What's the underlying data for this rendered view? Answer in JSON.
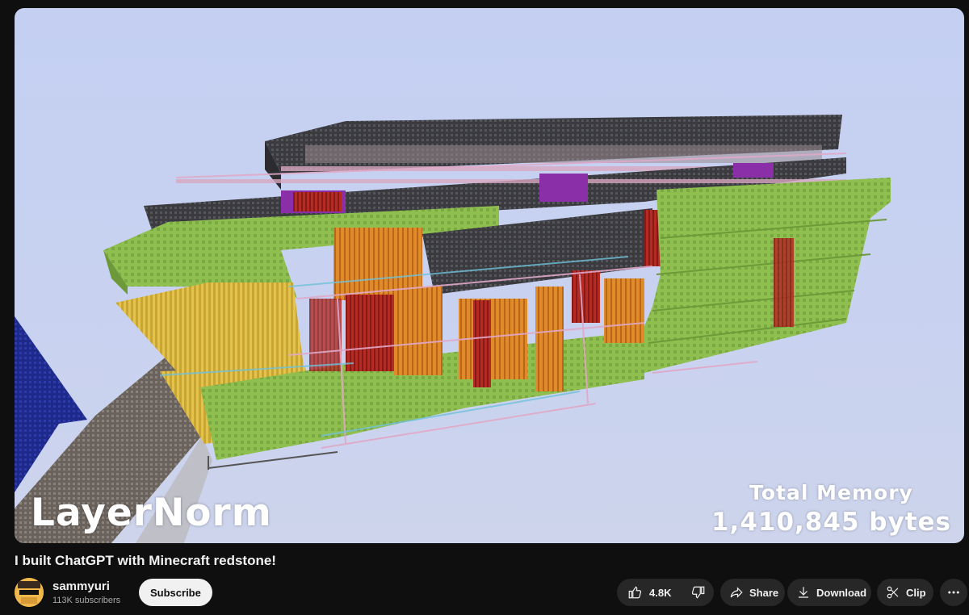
{
  "video": {
    "overlay_left": "LayerNorm",
    "overlay_right_line1": "Total Memory",
    "overlay_right_line2": "1,410,845 bytes"
  },
  "title": "I built ChatGPT with Minecraft redstone!",
  "channel": {
    "name": "sammyuri",
    "subscribers": "113K subscribers",
    "subscribe_label": "Subscribe"
  },
  "actions": {
    "like_count": "4.8K",
    "share_label": "Share",
    "download_label": "Download",
    "clip_label": "Clip"
  },
  "icons": {
    "like": "thumbs-up-icon",
    "dislike": "thumbs-down-icon",
    "share": "share-arrow-icon",
    "download": "download-icon",
    "clip": "scissors-icon",
    "more": "more-horizontal-icon"
  },
  "colors": {
    "page_background": "#0f0f0f",
    "pill_background": "#272727",
    "subscribe_background": "#f1f1f1",
    "sky": "#c8d2f0"
  }
}
